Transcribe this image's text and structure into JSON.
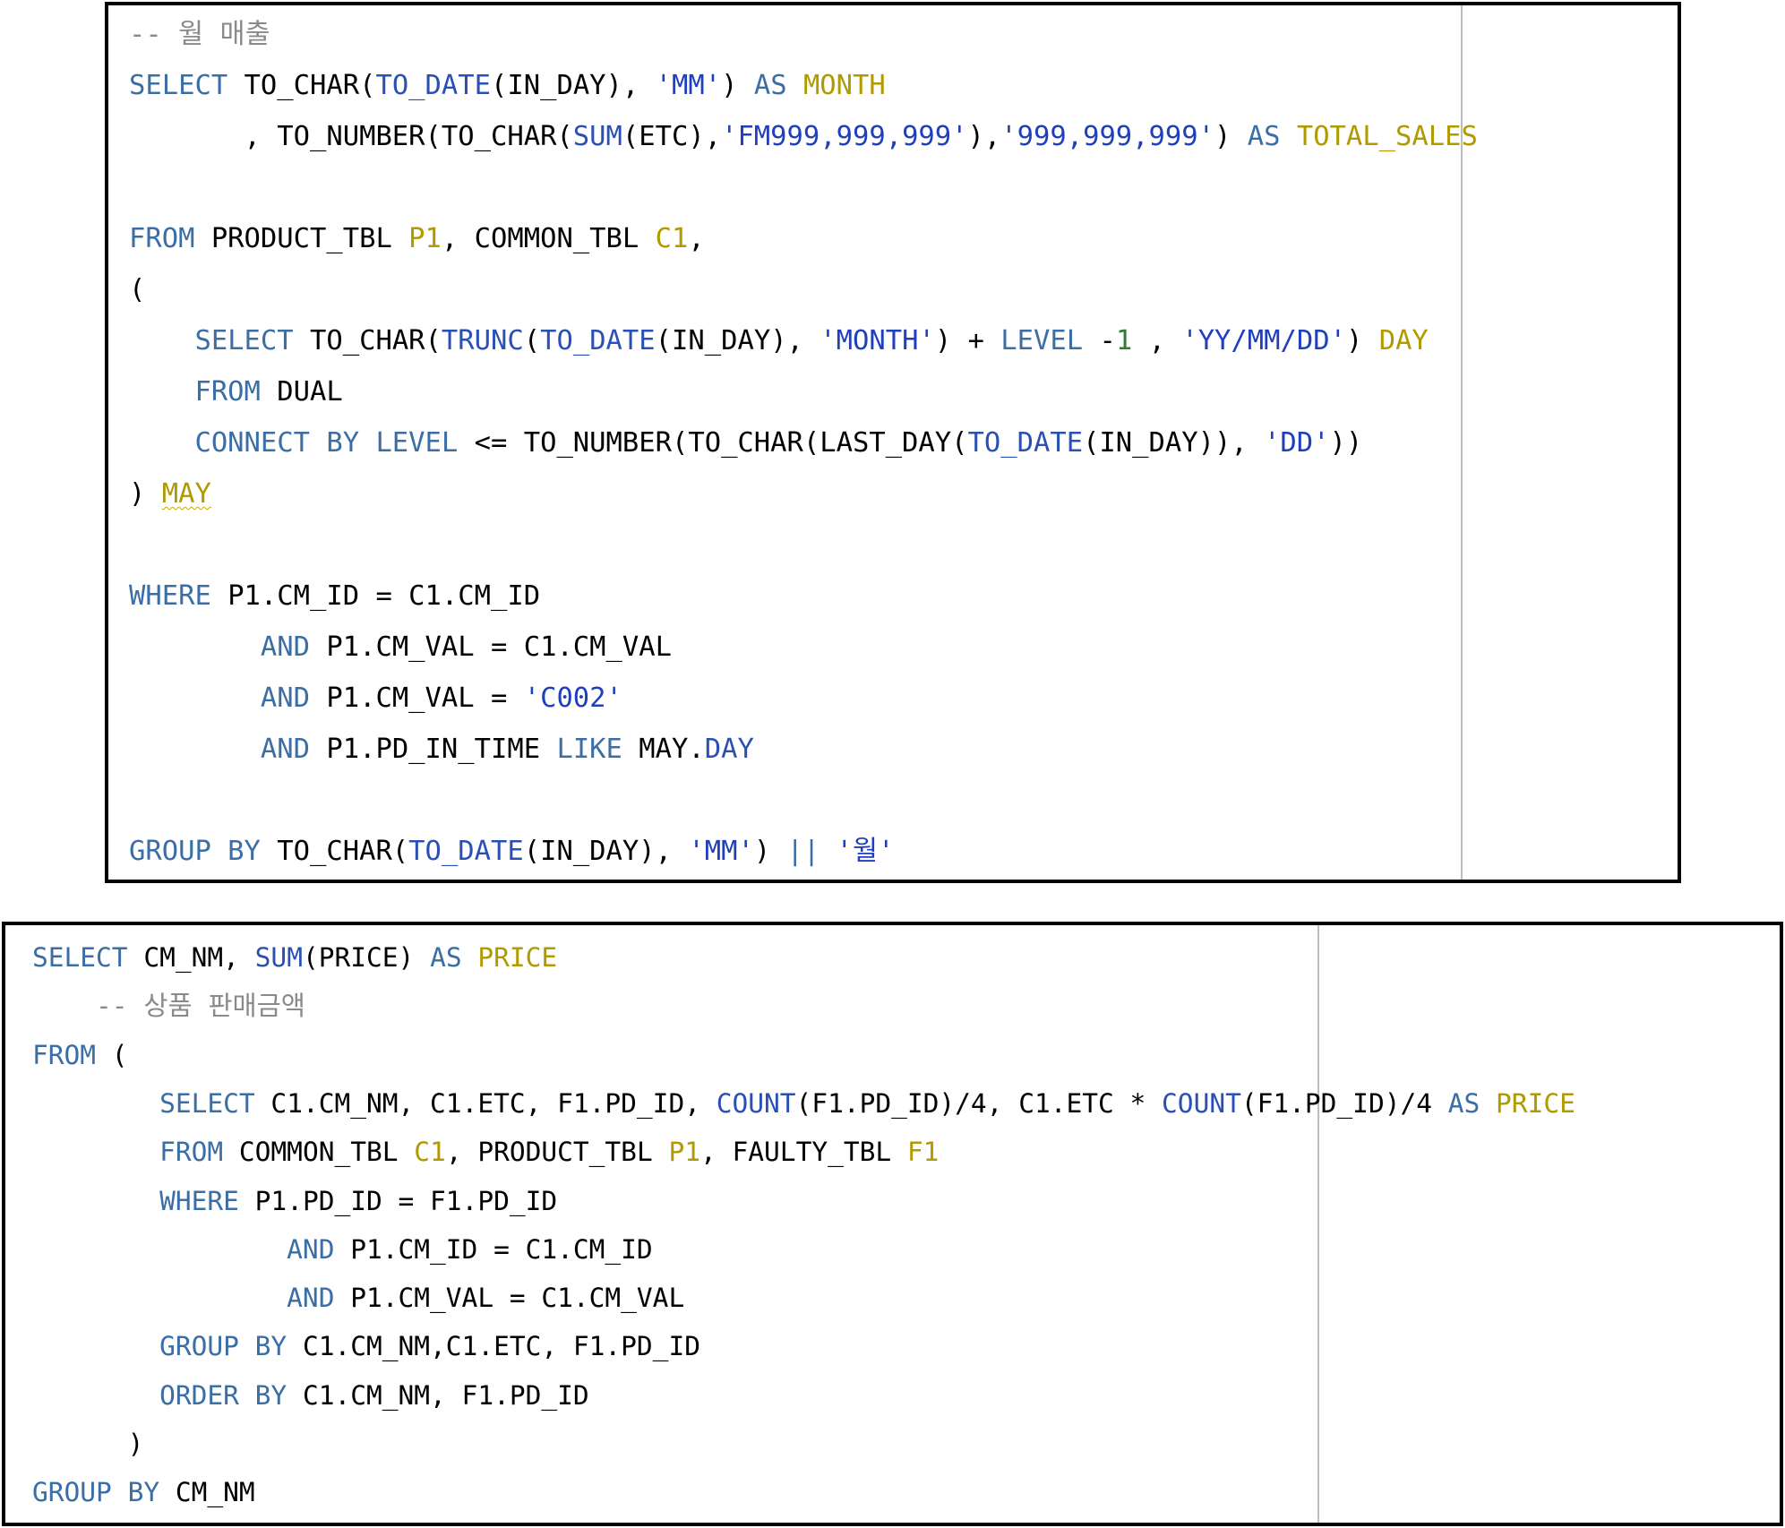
{
  "colors": {
    "keyword": "#3a6ea5",
    "function": "#2b50b5",
    "string": "#1f3fbd",
    "alias": "#b09a00",
    "identifier": "#000000",
    "number": "#2e7d32",
    "comment": "#8a8a8a",
    "border": "#000000",
    "guide_line": "#bdbdbd"
  },
  "panels": [
    {
      "name": "monthly-sales-query",
      "lines": [
        [
          [
            "cm",
            "-- 월 매출"
          ]
        ],
        [
          [
            "kw",
            "SELECT"
          ],
          [
            "id",
            " TO_CHAR("
          ],
          [
            "fn",
            "TO_DATE"
          ],
          [
            "id",
            "(IN_DAY), "
          ],
          [
            "str",
            "'MM'"
          ],
          [
            "id",
            ") "
          ],
          [
            "kw",
            "AS"
          ],
          [
            "id",
            " "
          ],
          [
            "al",
            "MONTH"
          ]
        ],
        [
          [
            "id",
            "       , TO_NUMBER(TO_CHAR("
          ],
          [
            "fn",
            "SUM"
          ],
          [
            "id",
            "(ETC),"
          ],
          [
            "str",
            "'FM999,999,999'"
          ],
          [
            "id",
            "),"
          ],
          [
            "str",
            "'999,999,999'"
          ],
          [
            "id",
            ") "
          ],
          [
            "kw",
            "AS"
          ],
          [
            "id",
            " "
          ],
          [
            "al",
            "TOTAL_SALES"
          ]
        ],
        [],
        [
          [
            "kw",
            "FROM"
          ],
          [
            "id",
            " PRODUCT_TBL "
          ],
          [
            "al",
            "P1"
          ],
          [
            "id",
            ", COMMON_TBL "
          ],
          [
            "al",
            "C1"
          ],
          [
            "id",
            ","
          ]
        ],
        [
          [
            "id",
            "("
          ]
        ],
        [
          [
            "id",
            "    "
          ],
          [
            "kw",
            "SELECT"
          ],
          [
            "id",
            " TO_CHAR("
          ],
          [
            "fn",
            "TRUNC"
          ],
          [
            "id",
            "("
          ],
          [
            "fn",
            "TO_DATE"
          ],
          [
            "id",
            "(IN_DAY), "
          ],
          [
            "str",
            "'MONTH'"
          ],
          [
            "id",
            ") + "
          ],
          [
            "kw",
            "LEVEL"
          ],
          [
            "id",
            " -"
          ],
          [
            "num",
            "1"
          ],
          [
            "id",
            " , "
          ],
          [
            "str",
            "'YY/MM/DD'"
          ],
          [
            "id",
            ") "
          ],
          [
            "al",
            "DAY"
          ]
        ],
        [
          [
            "id",
            "    "
          ],
          [
            "kw",
            "FROM"
          ],
          [
            "id",
            " DUAL"
          ]
        ],
        [
          [
            "id",
            "    "
          ],
          [
            "kw",
            "CONNECT BY LEVEL"
          ],
          [
            "id",
            " <= TO_NUMBER(TO_CHAR(LAST_DAY("
          ],
          [
            "fn",
            "TO_DATE"
          ],
          [
            "id",
            "(IN_DAY)), "
          ],
          [
            "str",
            "'DD'"
          ],
          [
            "id",
            "))"
          ]
        ],
        [
          [
            "id",
            ") "
          ],
          [
            "alw",
            "MAY"
          ]
        ],
        [],
        [
          [
            "kw",
            "WHERE"
          ],
          [
            "id",
            " P1.CM_ID = C1.CM_ID"
          ]
        ],
        [
          [
            "id",
            "        "
          ],
          [
            "kw",
            "AND"
          ],
          [
            "id",
            " P1.CM_VAL = C1.CM_VAL"
          ]
        ],
        [
          [
            "id",
            "        "
          ],
          [
            "kw",
            "AND"
          ],
          [
            "id",
            " P1.CM_VAL = "
          ],
          [
            "str",
            "'C002'"
          ]
        ],
        [
          [
            "id",
            "        "
          ],
          [
            "kw",
            "AND"
          ],
          [
            "id",
            " P1.PD_IN_TIME "
          ],
          [
            "kw",
            "LIKE"
          ],
          [
            "id",
            " MAY."
          ],
          [
            "fn",
            "DAY"
          ]
        ],
        [],
        [
          [
            "kw",
            "GROUP BY"
          ],
          [
            "id",
            " TO_CHAR("
          ],
          [
            "fn",
            "TO_DATE"
          ],
          [
            "id",
            "(IN_DAY), "
          ],
          [
            "str",
            "'MM'"
          ],
          [
            "id",
            ") "
          ],
          [
            "kw",
            "||"
          ],
          [
            "id",
            " "
          ],
          [
            "str",
            "'월'"
          ]
        ]
      ]
    },
    {
      "name": "product-sales-query",
      "lines": [
        [
          [
            "kw",
            "SELECT"
          ],
          [
            "id",
            " CM_NM, "
          ],
          [
            "fn",
            "SUM"
          ],
          [
            "id",
            "(PRICE) "
          ],
          [
            "kw",
            "AS"
          ],
          [
            "id",
            " "
          ],
          [
            "al",
            "PRICE"
          ]
        ],
        [
          [
            "id",
            "    "
          ],
          [
            "cm",
            "-- 상품 판매금액"
          ]
        ],
        [
          [
            "kw",
            "FROM"
          ],
          [
            "id",
            " ("
          ]
        ],
        [
          [
            "id",
            "        "
          ],
          [
            "kw",
            "SELECT"
          ],
          [
            "id",
            " C1.CM_NM, C1.ETC, F1.PD_ID, "
          ],
          [
            "fn",
            "COUNT"
          ],
          [
            "id",
            "(F1.PD_ID)/4, C1.ETC * "
          ],
          [
            "fn",
            "COUNT"
          ],
          [
            "id",
            "(F1.PD_ID)/4 "
          ],
          [
            "kw",
            "AS"
          ],
          [
            "id",
            " "
          ],
          [
            "al",
            "PRICE"
          ]
        ],
        [
          [
            "id",
            "        "
          ],
          [
            "kw",
            "FROM"
          ],
          [
            "id",
            " COMMON_TBL "
          ],
          [
            "al",
            "C1"
          ],
          [
            "id",
            ", PRODUCT_TBL "
          ],
          [
            "al",
            "P1"
          ],
          [
            "id",
            ", FAULTY_TBL "
          ],
          [
            "al",
            "F1"
          ]
        ],
        [
          [
            "id",
            "        "
          ],
          [
            "kw",
            "WHERE"
          ],
          [
            "id",
            " P1.PD_ID = F1.PD_ID"
          ]
        ],
        [
          [
            "id",
            "                "
          ],
          [
            "kw",
            "AND"
          ],
          [
            "id",
            " P1.CM_ID = C1.CM_ID"
          ]
        ],
        [
          [
            "id",
            "                "
          ],
          [
            "kw",
            "AND"
          ],
          [
            "id",
            " P1.CM_VAL = C1.CM_VAL"
          ]
        ],
        [
          [
            "id",
            "        "
          ],
          [
            "kw",
            "GROUP BY"
          ],
          [
            "id",
            " C1.CM_NM,C1.ETC, F1.PD_ID"
          ]
        ],
        [
          [
            "id",
            "        "
          ],
          [
            "kw",
            "ORDER BY"
          ],
          [
            "id",
            " C1.CM_NM, F1.PD_ID"
          ]
        ],
        [
          [
            "id",
            "      )"
          ]
        ],
        [
          [
            "kw",
            "GROUP BY"
          ],
          [
            "id",
            " CM_NM"
          ]
        ]
      ]
    }
  ]
}
